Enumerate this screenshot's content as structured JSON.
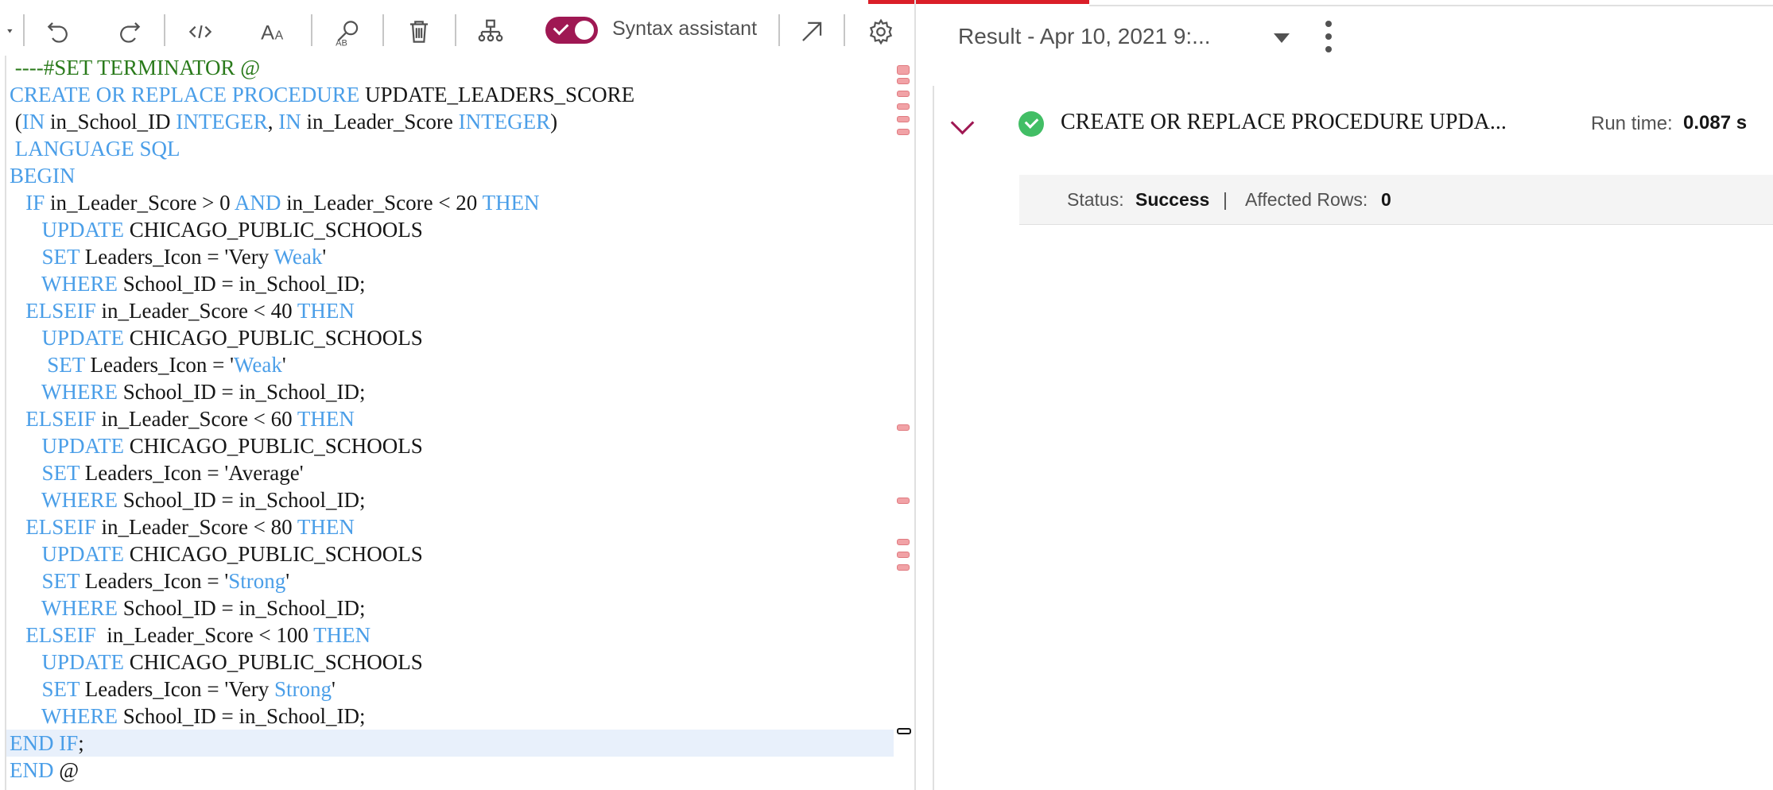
{
  "toolbar": {
    "buttons": [
      "collapse-arrow",
      "undo-icon",
      "redo-icon",
      "code-icon",
      "font-size-icon",
      "find-replace-icon",
      "delete-icon",
      "schema-icon",
      "open-external-icon",
      "settings-icon"
    ],
    "syntax_assistant_label": "Syntax assistant",
    "syntax_assistant_enabled": true,
    "accent_color": "#9f1853"
  },
  "editor": {
    "lines": [
      [
        {
          "t": " ----#SET TERMINATOR @",
          "c": "cm"
        }
      ],
      [
        {
          "t": "CREATE OR REPLACE PROCEDURE",
          "c": "kw"
        },
        {
          "t": " UPDATE_LEADERS_SCORE",
          "c": ""
        }
      ],
      [
        {
          "t": " (",
          "c": ""
        },
        {
          "t": "IN",
          "c": "kw"
        },
        {
          "t": " in_School_ID ",
          "c": ""
        },
        {
          "t": "INTEGER",
          "c": "kw"
        },
        {
          "t": ", ",
          "c": ""
        },
        {
          "t": "IN",
          "c": "kw"
        },
        {
          "t": " in_Leader_Score ",
          "c": ""
        },
        {
          "t": "INTEGER",
          "c": "kw"
        },
        {
          "t": ")",
          "c": ""
        }
      ],
      [
        {
          "t": " LANGUAGE SQL",
          "c": "kw"
        }
      ],
      [
        {
          "t": "BEGIN",
          "c": "kw"
        }
      ],
      [
        {
          "t": "   ",
          "c": ""
        },
        {
          "t": "IF",
          "c": "kw"
        },
        {
          "t": " in_Leader_Score > 0 ",
          "c": ""
        },
        {
          "t": "AND",
          "c": "kw"
        },
        {
          "t": " in_Leader_Score < 20 ",
          "c": ""
        },
        {
          "t": "THEN",
          "c": "kw"
        }
      ],
      [
        {
          "t": "      ",
          "c": ""
        },
        {
          "t": "UPDATE",
          "c": "kw"
        },
        {
          "t": " CHICAGO_PUBLIC_SCHOOLS",
          "c": ""
        }
      ],
      [
        {
          "t": "      ",
          "c": ""
        },
        {
          "t": "SET",
          "c": "kw"
        },
        {
          "t": " Leaders_Icon = 'Very ",
          "c": ""
        },
        {
          "t": "Weak",
          "c": "kw"
        },
        {
          "t": "'",
          "c": ""
        }
      ],
      [
        {
          "t": "      ",
          "c": ""
        },
        {
          "t": "WHERE",
          "c": "kw"
        },
        {
          "t": " School_ID = in_School_ID;",
          "c": ""
        }
      ],
      [
        {
          "t": "   ",
          "c": ""
        },
        {
          "t": "ELSEIF",
          "c": "kw"
        },
        {
          "t": " in_Leader_Score < 40 ",
          "c": ""
        },
        {
          "t": "THEN",
          "c": "kw"
        }
      ],
      [
        {
          "t": "      ",
          "c": ""
        },
        {
          "t": "UPDATE",
          "c": "kw"
        },
        {
          "t": " CHICAGO_PUBLIC_SCHOOLS",
          "c": ""
        }
      ],
      [
        {
          "t": "       ",
          "c": ""
        },
        {
          "t": "SET",
          "c": "kw"
        },
        {
          "t": " Leaders_Icon = '",
          "c": ""
        },
        {
          "t": "Weak",
          "c": "kw"
        },
        {
          "t": "'",
          "c": ""
        }
      ],
      [
        {
          "t": "      ",
          "c": ""
        },
        {
          "t": "WHERE",
          "c": "kw"
        },
        {
          "t": " School_ID = in_School_ID;",
          "c": ""
        }
      ],
      [
        {
          "t": "   ",
          "c": ""
        },
        {
          "t": "ELSEIF",
          "c": "kw"
        },
        {
          "t": " in_Leader_Score < 60 ",
          "c": ""
        },
        {
          "t": "THEN",
          "c": "kw"
        }
      ],
      [
        {
          "t": "      ",
          "c": ""
        },
        {
          "t": "UPDATE",
          "c": "kw"
        },
        {
          "t": " CHICAGO_PUBLIC_SCHOOLS",
          "c": ""
        }
      ],
      [
        {
          "t": "      ",
          "c": ""
        },
        {
          "t": "SET",
          "c": "kw"
        },
        {
          "t": " Leaders_Icon = 'Average'",
          "c": ""
        }
      ],
      [
        {
          "t": "      ",
          "c": ""
        },
        {
          "t": "WHERE",
          "c": "kw"
        },
        {
          "t": " School_ID = in_School_ID;",
          "c": ""
        }
      ],
      [
        {
          "t": "   ",
          "c": ""
        },
        {
          "t": "ELSEIF",
          "c": "kw"
        },
        {
          "t": " in_Leader_Score < 80 ",
          "c": ""
        },
        {
          "t": "THEN",
          "c": "kw"
        }
      ],
      [
        {
          "t": "      ",
          "c": ""
        },
        {
          "t": "UPDATE",
          "c": "kw"
        },
        {
          "t": " CHICAGO_PUBLIC_SCHOOLS",
          "c": ""
        }
      ],
      [
        {
          "t": "      ",
          "c": ""
        },
        {
          "t": "SET",
          "c": "kw"
        },
        {
          "t": " Leaders_Icon = '",
          "c": ""
        },
        {
          "t": "Strong",
          "c": "kw"
        },
        {
          "t": "'",
          "c": ""
        }
      ],
      [
        {
          "t": "      ",
          "c": ""
        },
        {
          "t": "WHERE",
          "c": "kw"
        },
        {
          "t": " School_ID = in_School_ID;",
          "c": ""
        }
      ],
      [
        {
          "t": "   ",
          "c": ""
        },
        {
          "t": "ELSEIF",
          "c": "kw"
        },
        {
          "t": "  in_Leader_Score < 100 ",
          "c": ""
        },
        {
          "t": "THEN",
          "c": "kw"
        }
      ],
      [
        {
          "t": "      ",
          "c": ""
        },
        {
          "t": "UPDATE",
          "c": "kw"
        },
        {
          "t": " CHICAGO_PUBLIC_SCHOOLS",
          "c": ""
        }
      ],
      [
        {
          "t": "      ",
          "c": ""
        },
        {
          "t": "SET",
          "c": "kw"
        },
        {
          "t": " Leaders_Icon = 'Very ",
          "c": ""
        },
        {
          "t": "Strong",
          "c": "kw"
        },
        {
          "t": "'",
          "c": ""
        }
      ],
      [
        {
          "t": "      ",
          "c": ""
        },
        {
          "t": "WHERE",
          "c": "kw"
        },
        {
          "t": " School_ID = in_School_ID;",
          "c": ""
        }
      ],
      [
        {
          "t": "END IF",
          "c": "kw"
        },
        {
          "t": ";",
          "c": ""
        }
      ],
      [
        {
          "t": "END",
          "c": "kw"
        },
        {
          "t": " @",
          "c": ""
        }
      ]
    ],
    "active_line": 25
  },
  "result": {
    "title": "Result - Apr 10, 2021 9:...",
    "statement": "CREATE OR REPLACE PROCEDURE UPDA...",
    "run_time_label": "Run time:",
    "run_time_value": "0.087 s",
    "status_label": "Status:",
    "status_value": "Success",
    "separator": "|",
    "affected_rows_label": "Affected Rows:",
    "affected_rows_value": "0"
  }
}
